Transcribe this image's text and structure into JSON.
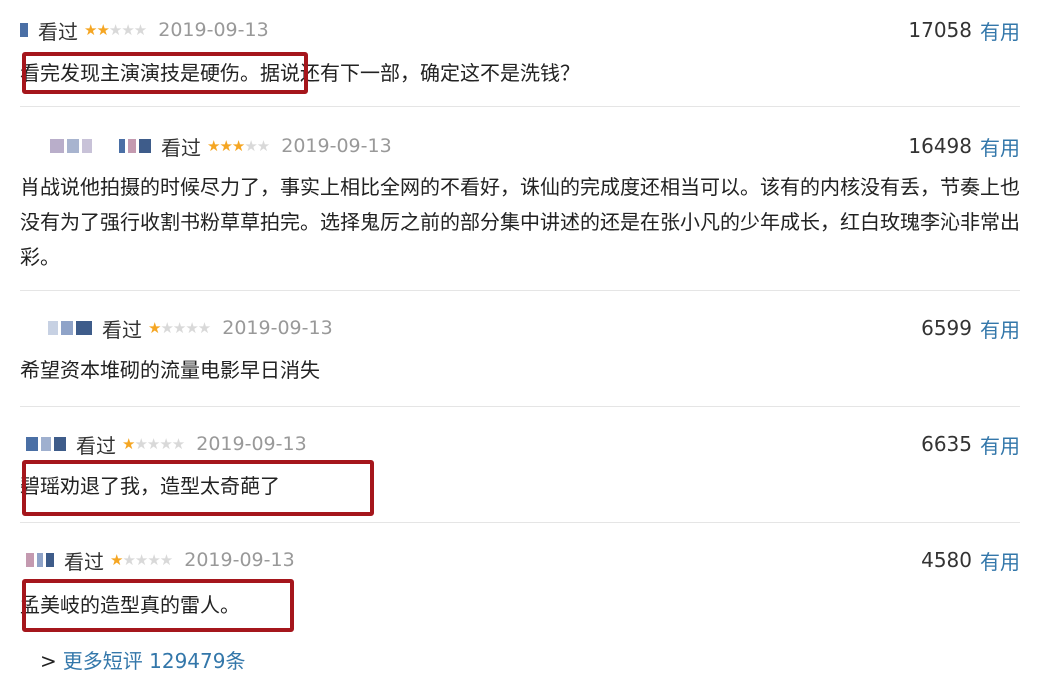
{
  "comments": [
    {
      "status": "看过",
      "stars": "★★",
      "stars_off": "★★★",
      "date": "2019-09-13",
      "votes": "17058",
      "useful_label": "有用",
      "text": "看完发现主演演技是硬伤。据说还有下一部，确定这不是洗钱？",
      "highlighted": "看完发现主演演技是硬伤。"
    },
    {
      "status": "看过",
      "stars": "★★★",
      "stars_off": "★★",
      "date": "2019-09-13",
      "votes": "16498",
      "useful_label": "有用",
      "text": "肖战说他拍摄的时候尽力了，事实上相比全网的不看好，诛仙的完成度还相当可以。该有的内核没有丢，节奏上也没有为了强行收割书粉草草拍完。选择鬼厉之前的部分集中讲述的还是在张小凡的少年成长，红白玫瑰李沁非常出彩。"
    },
    {
      "status": "看过",
      "stars": "★",
      "stars_off": "★★★★",
      "date": "2019-09-13",
      "votes": "6599",
      "useful_label": "有用",
      "text": "希望资本堆砌的流量电影早日消失"
    },
    {
      "status": "看过",
      "stars": "★",
      "stars_off": "★★★★",
      "date": "2019-09-13",
      "votes": "6635",
      "useful_label": "有用",
      "text": "碧瑶劝退了我，造型太奇葩了",
      "highlighted": "碧瑶劝退了我，造型太奇葩了"
    },
    {
      "status": "看过",
      "stars": "★",
      "stars_off": "★★★★",
      "date": "2019-09-13",
      "votes": "4580",
      "useful_label": "有用",
      "text": "孟美岐的造型真的雷人。",
      "highlighted": "孟美岐的造型真的雷人。"
    }
  ],
  "more_link": {
    "arrow": ">",
    "label": "更多短评 129479条"
  },
  "colors": {
    "star": "#f5a623",
    "link": "#3377aa",
    "highlight_box": "#a5161c"
  }
}
